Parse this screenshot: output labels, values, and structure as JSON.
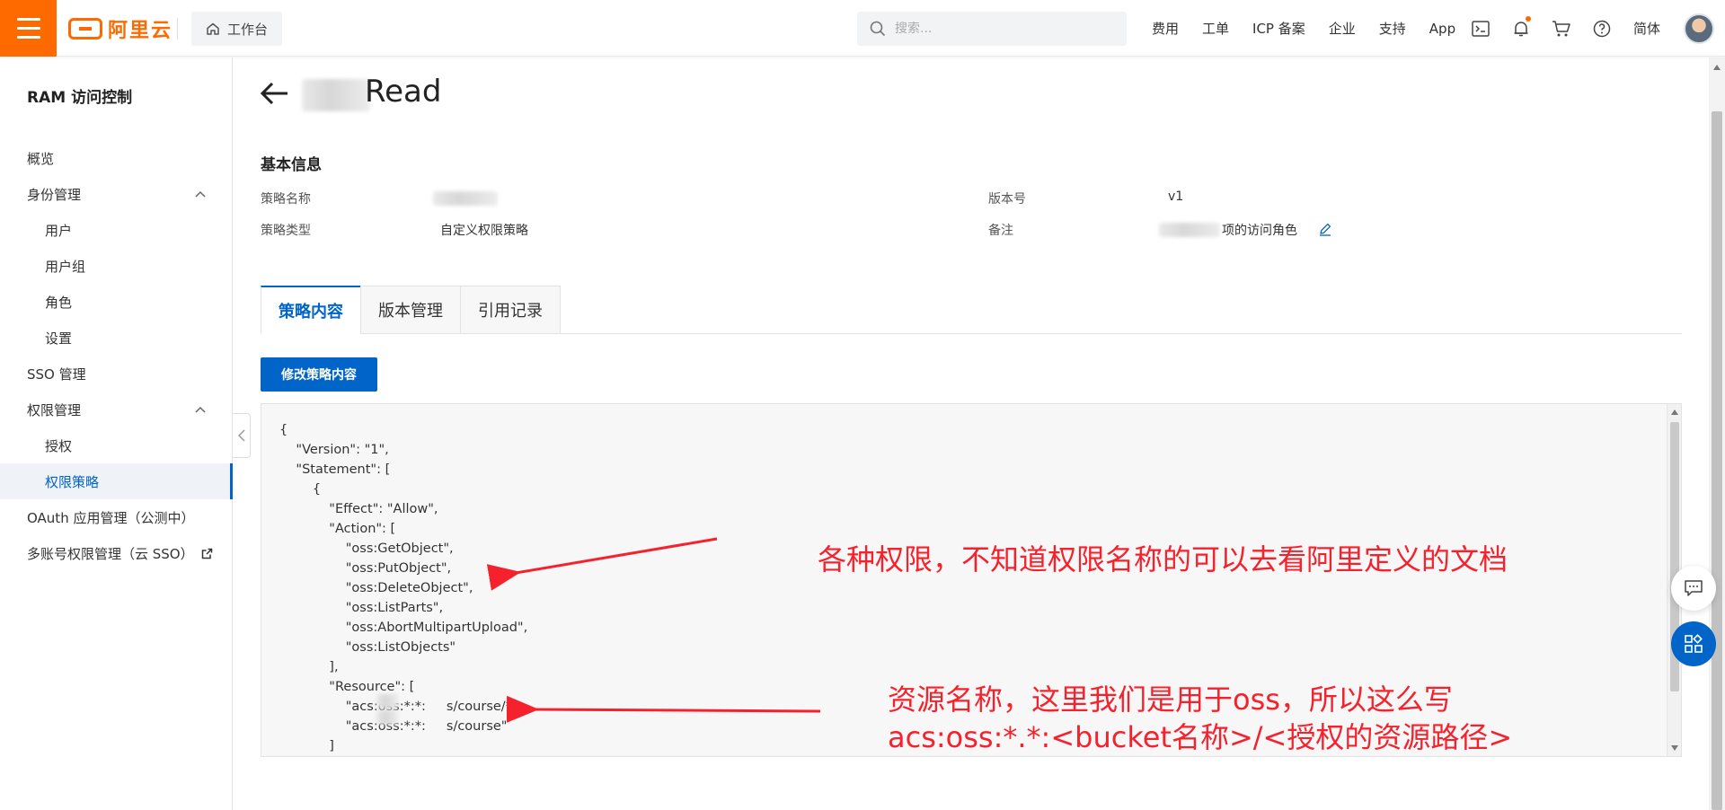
{
  "topbar": {
    "logo_text": "阿里云",
    "workbench_label": "工作台",
    "search_placeholder": "搜索...",
    "links": [
      "费用",
      "工单",
      "ICP 备案",
      "企业",
      "支持",
      "App"
    ],
    "language": "简体",
    "icons": [
      "terminal-icon",
      "bell-icon",
      "cart-icon",
      "help-icon"
    ],
    "brand_color": "#ff6a00"
  },
  "sidebar": {
    "title": "RAM 访问控制",
    "items": [
      {
        "label": "概览",
        "level": 1
      },
      {
        "label": "身份管理",
        "level": 1,
        "expanded": true
      },
      {
        "label": "用户",
        "level": 2
      },
      {
        "label": "用户组",
        "level": 2
      },
      {
        "label": "角色",
        "level": 2
      },
      {
        "label": "设置",
        "level": 2
      },
      {
        "label": "SSO 管理",
        "level": 1
      },
      {
        "label": "权限管理",
        "level": 1,
        "expanded": true
      },
      {
        "label": "授权",
        "level": 2
      },
      {
        "label": "权限策略",
        "level": 2,
        "active": true
      },
      {
        "label": "OAuth 应用管理（公测中）",
        "level": 1
      },
      {
        "label": "多账号权限管理（云 SSO）",
        "level": 1
      }
    ]
  },
  "page": {
    "title_suffix": "Read",
    "section_title": "基本信息",
    "info": {
      "policy_name_label": "策略名称",
      "policy_type_label": "策略类型",
      "policy_type_value": "自定义权限策略",
      "version_label": "版本号",
      "version_value": "v1",
      "remark_label": "备注",
      "remark_value": "项的访问角色"
    },
    "tabs": [
      "策略内容",
      "版本管理",
      "引用记录"
    ],
    "active_tab": "策略内容",
    "edit_button": "修改策略内容",
    "code_lines": [
      "{",
      "    \"Version\": \"1\",",
      "    \"Statement\": [",
      "        {",
      "            \"Effect\": \"Allow\",",
      "            \"Action\": [",
      "                \"oss:GetObject\",",
      "                \"oss:PutObject\",",
      "                \"oss:DeleteObject\",",
      "                \"oss:ListParts\",",
      "                \"oss:AbortMultipartUpload\",",
      "                \"oss:ListObjects\"",
      "            ],",
      "            \"Resource\": [",
      "                \"acs:oss:*:*:     s/course/*\",",
      "                \"acs:oss:*:*:     s/course\"",
      "            ]"
    ]
  },
  "annotations": {
    "action_note": "各种权限，不知道权限名称的可以去看阿里定义的文档",
    "resource_note_line1": "资源名称，这里我们是用于oss，所以这么写",
    "resource_note_line2": "acs:oss:*.*:<bucket名称>/<授权的资源路径>",
    "color": "#f5222d"
  },
  "accent_color": "#0064c8"
}
